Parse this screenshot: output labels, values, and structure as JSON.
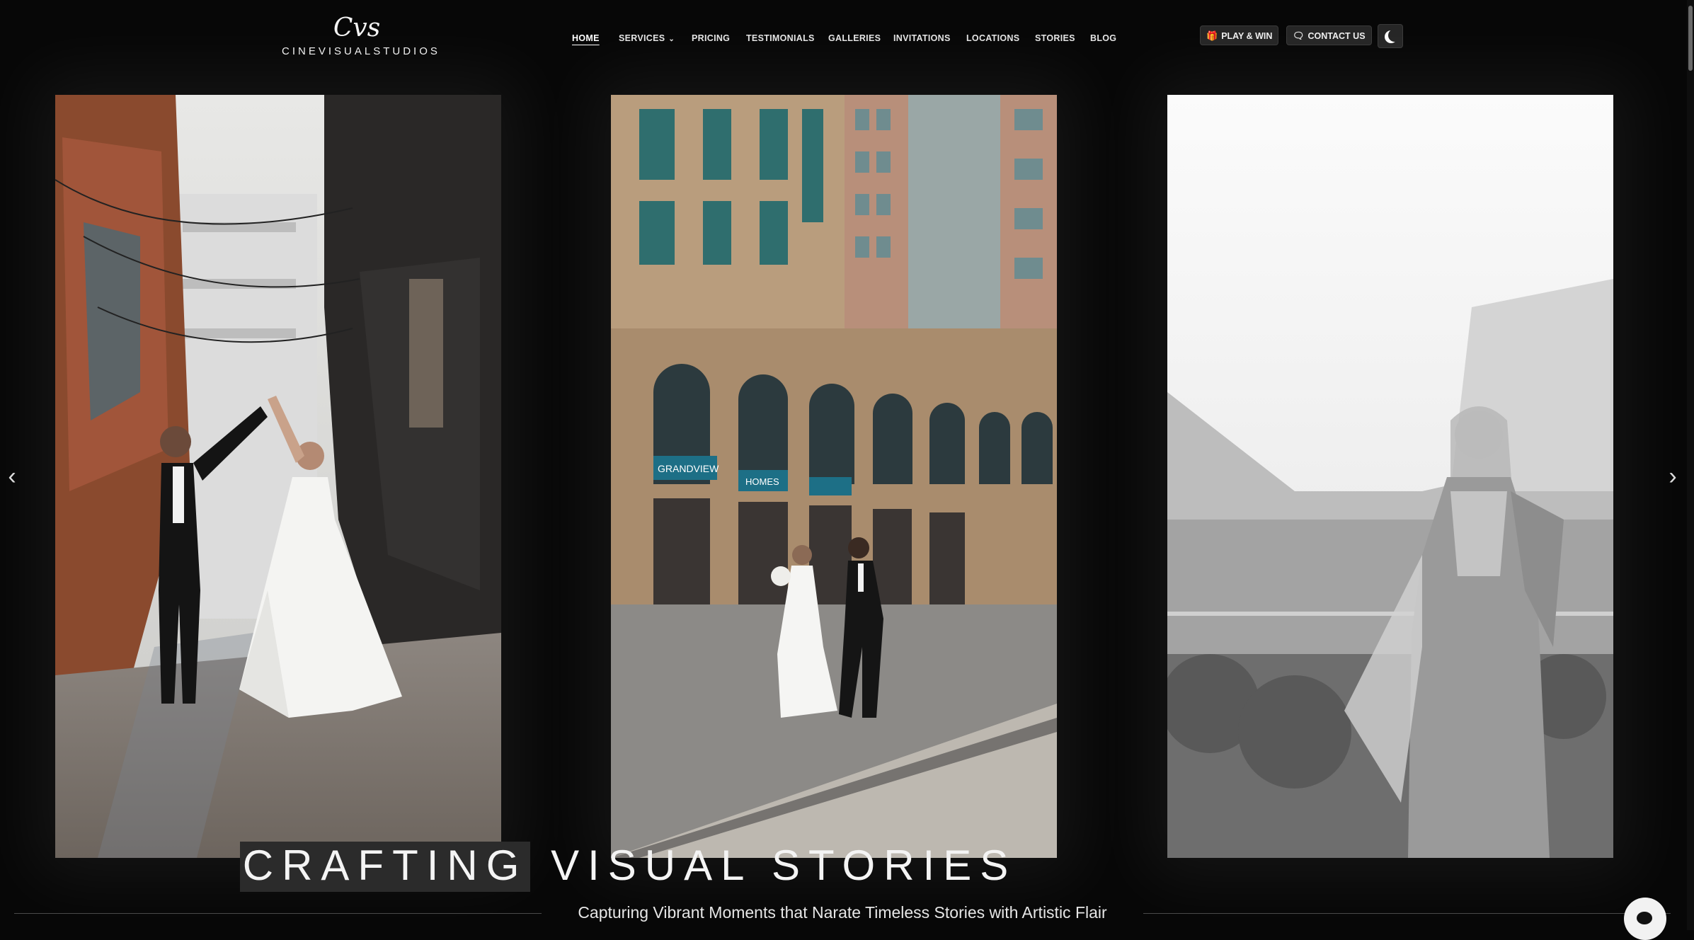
{
  "brand": {
    "monogram": "Cvs",
    "wordmark": "CINEVISUALSTUDIOS"
  },
  "nav": {
    "items": [
      {
        "label": "HOME",
        "active": true
      },
      {
        "label": "SERVICES",
        "has_dropdown": true
      },
      {
        "label": "PRICING"
      },
      {
        "label": "TESTIMONIALS"
      },
      {
        "label": "GALLERIES"
      },
      {
        "label": "INVITATIONS"
      },
      {
        "label": "LOCATIONS"
      },
      {
        "label": "STORIES"
      },
      {
        "label": "BLOG"
      }
    ]
  },
  "header_buttons": {
    "play": {
      "label": "PLAY & WIN",
      "icon": "gift-icon"
    },
    "contact": {
      "label": "CONTACT US",
      "icon": "chat-icon"
    },
    "theme": {
      "icon": "moon-icon"
    }
  },
  "gallery": {
    "photos": [
      {
        "name": "couple-dancing-alley",
        "style": "color"
      },
      {
        "name": "couple-walking-street",
        "style": "color"
      },
      {
        "name": "bride-saree-mountains",
        "style": "black-and-white"
      }
    ],
    "signs": {
      "grandview": "GRANDVIEW",
      "homes": "HOMES"
    }
  },
  "hero": {
    "title_highlight": "CRAFTING",
    "title_rest": "VISUAL STORIES",
    "subtitle": "Capturing Vibrant Moments that Narate Timeless Stories with Artistic Flair"
  },
  "colors": {
    "background": "#070707",
    "text": "#f4f4f4",
    "button_bg": "#262626"
  }
}
